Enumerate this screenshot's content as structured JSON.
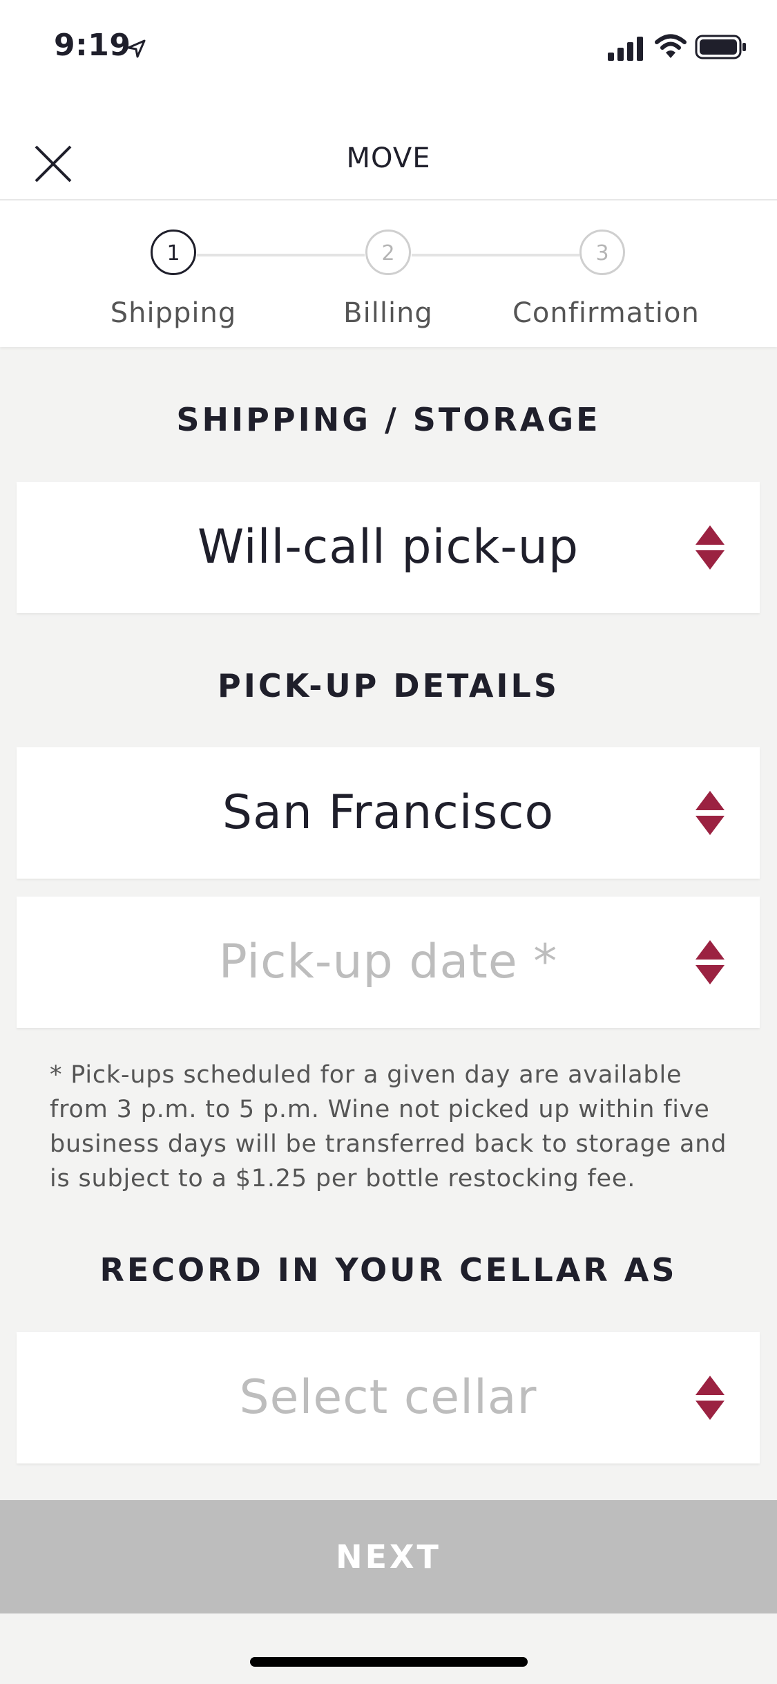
{
  "status_bar": {
    "time": "9:19"
  },
  "header": {
    "title": "MOVE"
  },
  "steps": [
    {
      "number": "1",
      "label": "Shipping",
      "state": "active"
    },
    {
      "number": "2",
      "label": "Billing",
      "state": "inactive"
    },
    {
      "number": "3",
      "label": "Confirmation",
      "state": "inactive"
    }
  ],
  "shipping_section": {
    "heading": "SHIPPING / STORAGE",
    "method_value": "Will-call pick-up"
  },
  "pickup_section": {
    "heading": "PICK-UP DETAILS",
    "location_value": "San Francisco",
    "date_placeholder": "Pick-up date *",
    "note": "* Pick-ups scheduled for a given day are available from 3 p.m. to 5 p.m. Wine not picked up within five business days will be transferred back to storage and is subject to a $1.25 per bottle restocking fee."
  },
  "cellar_section": {
    "heading": "RECORD IN YOUR CELLAR AS",
    "cellar_placeholder": "Select cellar"
  },
  "next_button": {
    "label": "NEXT",
    "state": "disabled"
  },
  "colors": {
    "accent": "#9b2241",
    "disabled_button": "#bdbdbd",
    "background": "#f3f3f2"
  },
  "icons": [
    "location-arrow-icon",
    "cellular-signal-icon",
    "wifi-icon",
    "battery-icon",
    "close-icon",
    "sort-arrows-icon"
  ]
}
